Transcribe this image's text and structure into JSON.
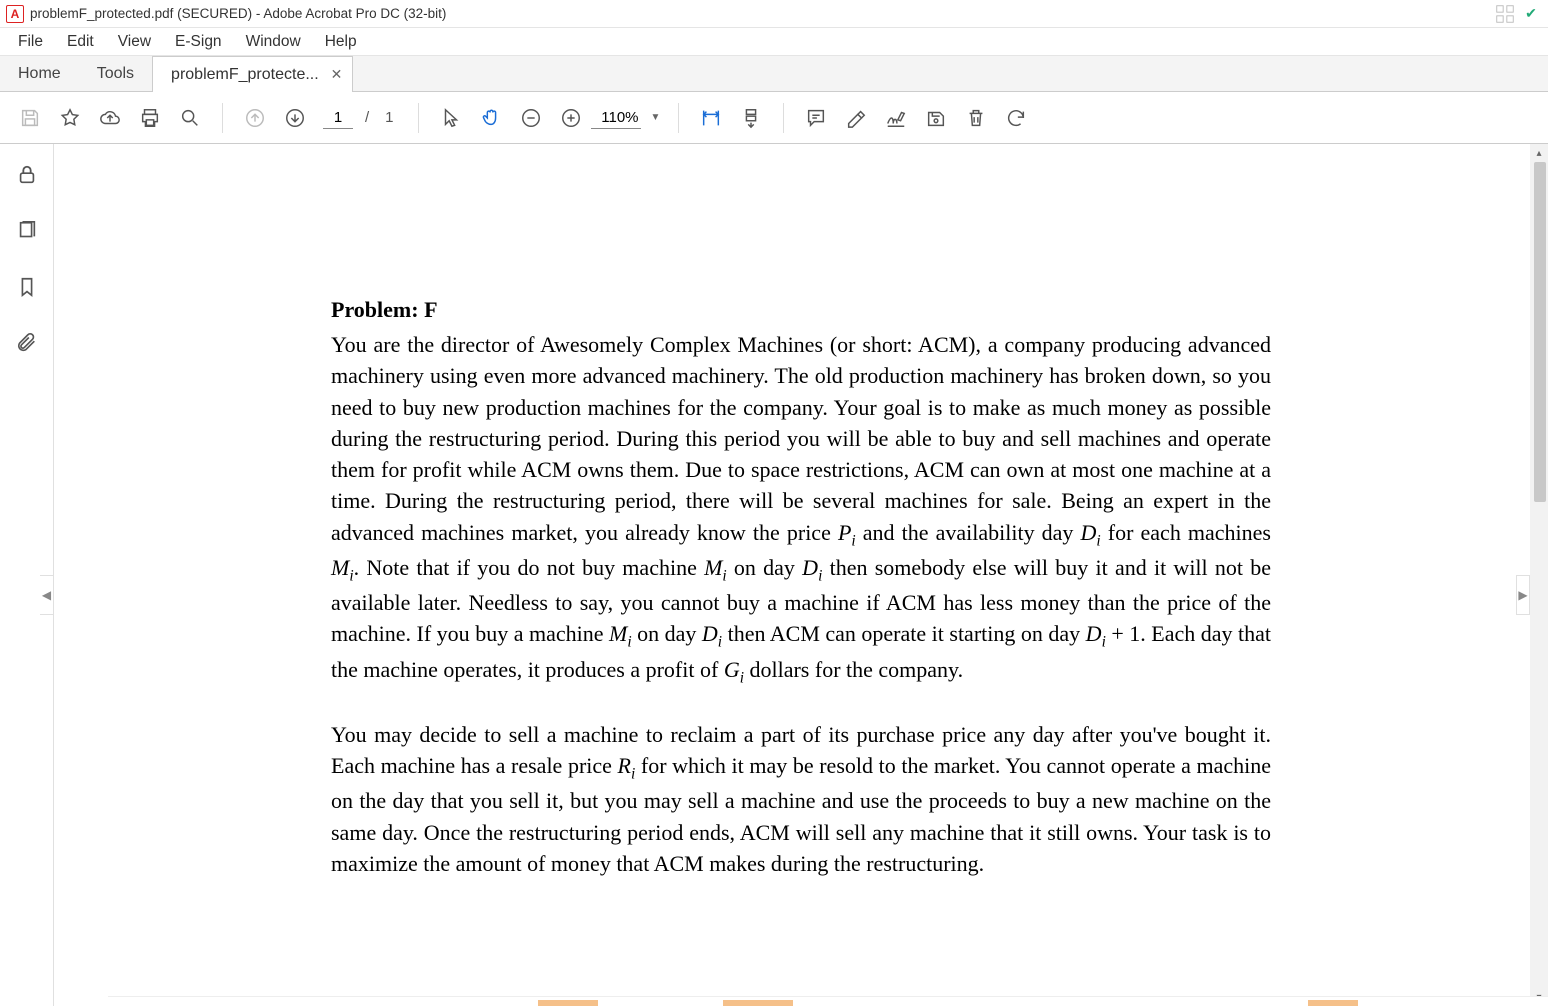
{
  "titlebar": {
    "text": "problemF_protected.pdf (SECURED) - Adobe Acrobat Pro DC (32-bit)"
  },
  "menubar": {
    "items": [
      "File",
      "Edit",
      "View",
      "E-Sign",
      "Window",
      "Help"
    ]
  },
  "tabs": {
    "home": "Home",
    "tools": "Tools",
    "doc": "problemF_protecte..."
  },
  "toolbar": {
    "page_current": "1",
    "page_sep": "/",
    "page_total": "1",
    "zoom": "110%"
  },
  "document": {
    "heading": "Problem: F",
    "para1_parts": {
      "t0": "You are the director of Awesomely Complex Machines (or short: ACM), a company producing advanced machinery using even more advanced machinery. The old production machinery has broken down, so you need to buy new production machines for the company. Your goal is to make as much money as possible during the restructuring period. During this period you will be able to buy and sell machines and operate them for profit while ACM owns them. Due to space restrictions, ACM can own at most one machine at a time. During the restructuring period, there will be several machines for sale. Being an expert in the advanced machines market, you already know the price ",
      "P": "P",
      "Pi": "i",
      "t1": " and the availability day ",
      "D1": "D",
      "D1i": "i",
      "t2": " for each machines ",
      "M1": "M",
      "M1i": "i",
      "t3": ". Note that if you do not buy machine ",
      "M2": "M",
      "M2i": "i",
      "t4": " on day ",
      "D2": "D",
      "D2i": "i",
      "t5": " then somebody else will buy it and it will not be available later. Needless to say, you cannot buy a machine if ACM has less money than the price of the machine. If you buy a machine ",
      "M3": "M",
      "M3i": "i",
      "t6": " on day ",
      "D3": "D",
      "D3i": "i",
      "t7": "  then ACM can operate it starting on day ",
      "D4": "D",
      "D4i": "i",
      "t8": " + 1. Each day that the machine operates, it produces a profit of ",
      "G": "G",
      "Gi": "i",
      "t9": " dollars for the company."
    },
    "para2_parts": {
      "t0": "You may decide to sell a machine to reclaim a part of its purchase price any day after you've bought it. Each machine has a resale price ",
      "R": "R",
      "Ri": "i",
      "t1": " for which it may be resold to the market. You cannot operate a machine on the day that you sell it, but you may sell a machine and use the proceeds to buy a new machine on the same day. Once the restructuring period ends, ACM will sell any machine that it still owns. Your task is to maximize the amount of money that ACM makes during the restructuring."
    }
  }
}
